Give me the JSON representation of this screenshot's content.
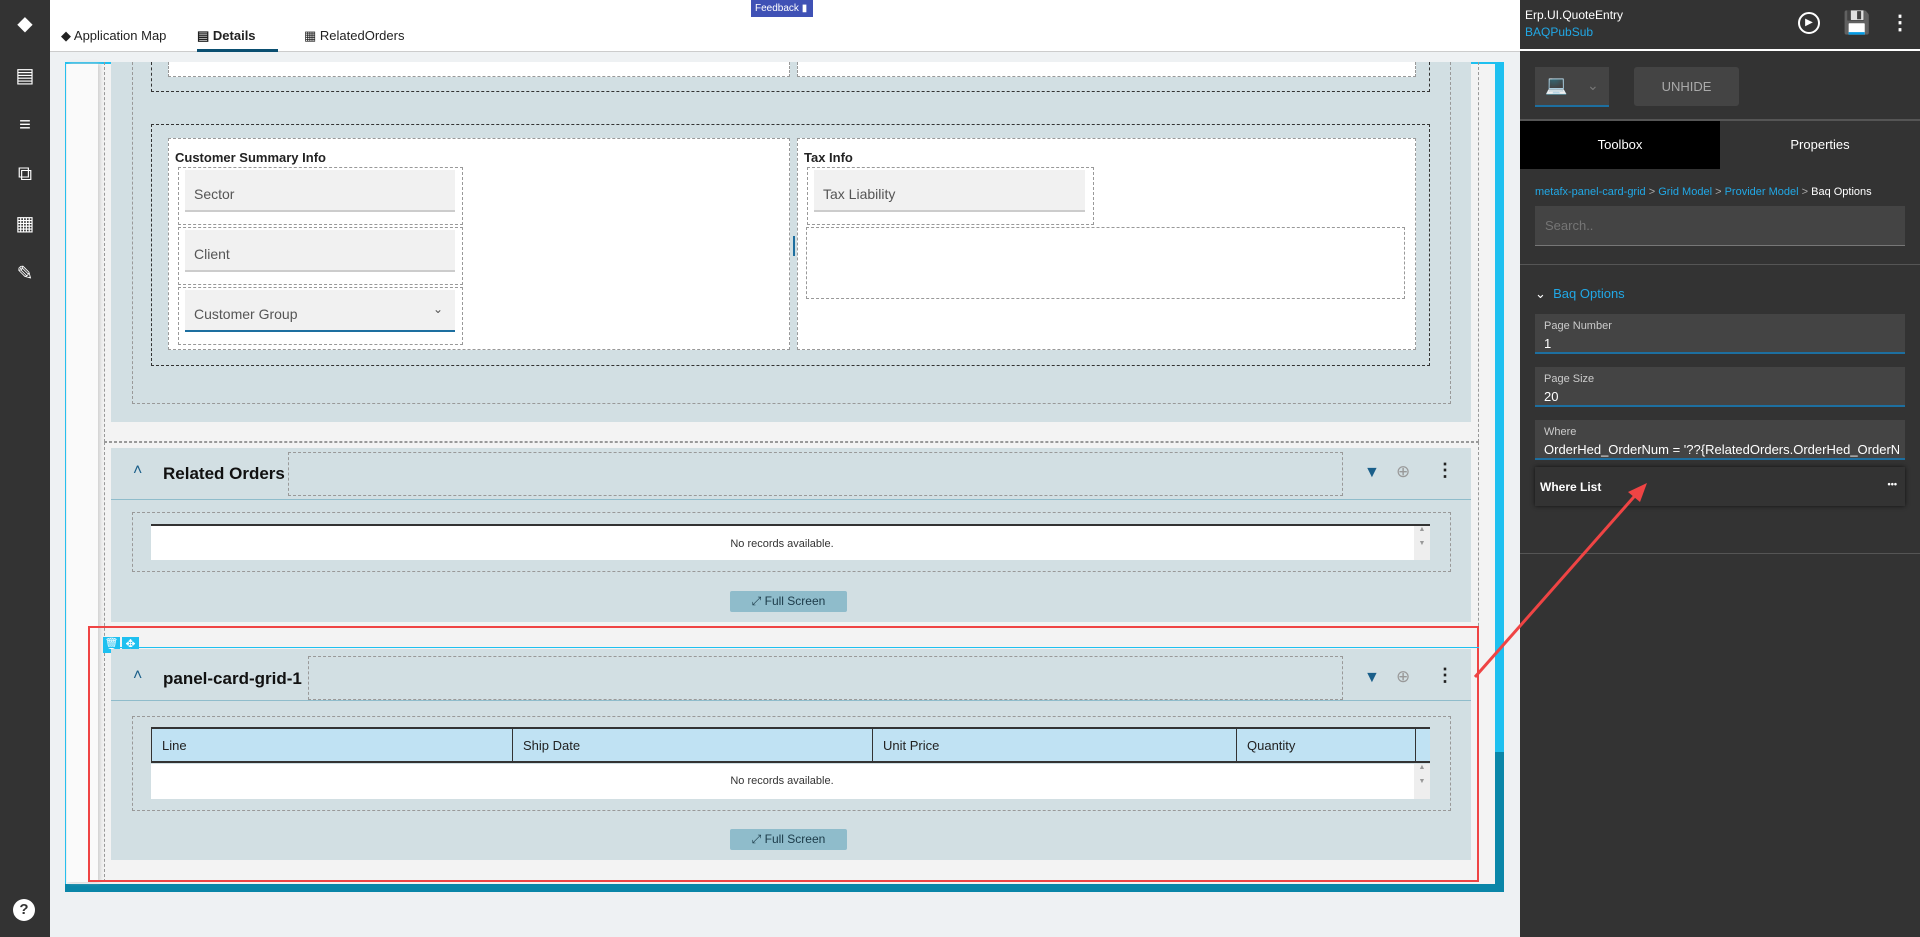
{
  "sidebar": {
    "icons": [
      "layers-icon",
      "layout-icon",
      "checklist-icon",
      "flow-icon",
      "grid-icon",
      "edit-doc-icon"
    ],
    "help": "?"
  },
  "tabs": [
    {
      "label": "Application Map"
    },
    {
      "label": "Details"
    },
    {
      "label": "RelatedOrders"
    }
  ],
  "feedback": "Feedback",
  "customer_summary": {
    "title": "Customer Summary Info",
    "fields": [
      "Sector",
      "Client",
      "Customer Group"
    ]
  },
  "tax_info": {
    "title": "Tax Info",
    "fields": [
      "Tax Liability"
    ]
  },
  "related_orders": {
    "title": "Related Orders",
    "no_records": "No records available.",
    "full_screen": "Full Screen"
  },
  "panel_grid": {
    "title": "panel-card-grid-1",
    "columns": [
      "Line",
      "Ship Date",
      "Unit Price",
      "Quantity"
    ],
    "no_records": "No records available.",
    "full_screen": "Full Screen"
  },
  "right": {
    "app_name": "Erp.UI.QuoteEntry",
    "layer": "BAQPubSub",
    "unhide": "UNHIDE",
    "tabs": [
      "Toolbox",
      "Properties"
    ],
    "breadcrumb": [
      "metafx-panel-card-grid",
      "Grid Model",
      "Provider Model",
      "Baq Options"
    ],
    "sep": ">",
    "search_placeholder": "Search..",
    "section": "Baq Options",
    "fields": [
      {
        "label": "Page Number",
        "value": "1"
      },
      {
        "label": "Page Size",
        "value": "20"
      },
      {
        "label": "Where",
        "value": "OrderHed_OrderNum = '??{RelatedOrders.OrderHed_OrderNum}'"
      }
    ],
    "where_list": "Where List",
    "where_list_more": "•••"
  },
  "colors": {
    "accent": "#21a8e6",
    "selection": "#ef4444",
    "panel": "#d2dfe3"
  }
}
